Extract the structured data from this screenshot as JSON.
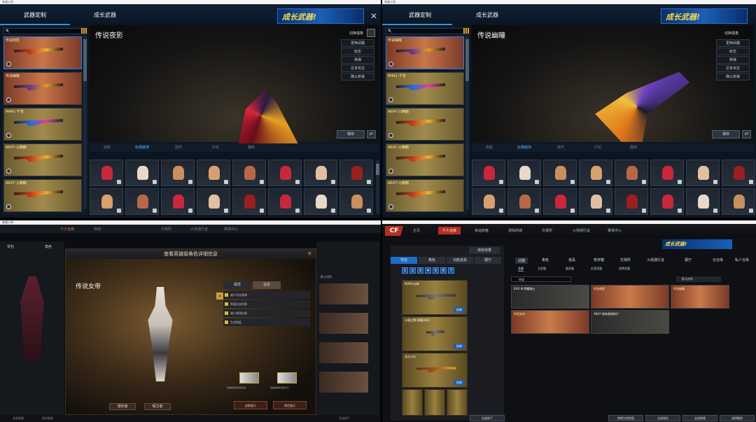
{
  "q1": {
    "winbar": "穿越火线",
    "tabs": [
      "武器定制",
      "成长武器"
    ],
    "banner": "成长武器!",
    "close": "✕",
    "stage_title": "传说夜影",
    "view_label": "切换视角",
    "menu": [
      "更换武器",
      "射击",
      "换弹",
      "近身攻击",
      "确认枪械"
    ],
    "save": "保存",
    "subtabs": [
      "皮肤",
      "玩偶装饰",
      "挂件",
      "印花",
      "翻转"
    ],
    "weapons": [
      "传说夜影",
      "传说幽瞳",
      "M4A1-千变",
      "AK47-火麒麟",
      "AK47-火麒麟"
    ]
  },
  "q2": {
    "winbar": "穿越火线",
    "tabs": [
      "武器定制",
      "成长武器"
    ],
    "banner": "成长武器!",
    "stage_title": "传说幽瞳",
    "view_label": "切换视角",
    "menu": [
      "更换武器",
      "射击",
      "换弹",
      "近身攻击",
      "确认枪械"
    ],
    "save": "保存",
    "subtabs": [
      "皮肤",
      "玩偶装饰",
      "挂件",
      "印花",
      "翻转"
    ],
    "weapons": [
      "传说幽瞳",
      "M4A1-千变",
      "AK47-火麒麟",
      "AK47-火麒麟",
      "AK47-火麒麟"
    ]
  },
  "q3": {
    "winbar": "穿越火线",
    "nav": [
      "个人仓库",
      "商城",
      "交易所",
      "火线通行证",
      "赛事中心"
    ],
    "left_tabs": [
      "背包",
      "角色"
    ],
    "modal_title": "查看英雄级角色详细信息",
    "hero_name": "传说女帝",
    "ptabs": [
      "属性",
      "设定"
    ],
    "skills": [
      "减少闪光效果",
      "免疫队友伤害",
      "减少掉落伤害",
      "生化免疫"
    ],
    "btn_left": "潜伏者",
    "btn_right": "保卫者",
    "portrait_desc": [
      "英雄级角色定制头像",
      "英雄级角色定制卡片"
    ],
    "bottom_buttons": [
      "皮肤展示",
      "角色展示"
    ],
    "footer": [
      "全部装备",
      "角色装备",
      "全部卸下"
    ],
    "right_label": "默认排序",
    "right_footer": "全部卸下"
  },
  "q4": {
    "logo": "CF",
    "nav": [
      "主页",
      "个人仓库",
      "幸运转盘",
      "游戏商城",
      "交易所",
      "火线通行证",
      "赛事中心"
    ],
    "banner": "成长武器!",
    "holding": "持有效果",
    "left_tabs": [
      "背包",
      "角色",
      "功能道具",
      "展厅"
    ],
    "nums": [
      "1",
      "2",
      "3",
      "4",
      "5",
      "6",
      "7"
    ],
    "left_weapons": [
      {
        "name": "M200-幻神",
        "dis": "拆卸"
      },
      {
        "name": "沙漠之鹰-荣耀2023",
        "dis": "拆卸"
      },
      {
        "name": "龙之爪刃",
        "dis": "拆卸"
      }
    ],
    "right_tabs": [
      "武器",
      "角色",
      "道具",
      "暂存箱",
      "交易所",
      "火线通行证",
      "展厅",
      "云仓库",
      "私人仓库"
    ],
    "subs": [
      "全部",
      "主武器",
      "副武器",
      "近身武器",
      "投掷武器"
    ],
    "search": "传说",
    "sort": "默认排序",
    "right_weapons": [
      {
        "name": "EVO III-荣耀骑士"
      },
      {
        "name": "传说夜影"
      },
      {
        "name": "传说幽瞳"
      },
      {
        "name": "传说女帝"
      },
      {
        "name": "AK47-皇帝青铜碎片"
      }
    ],
    "bottom": [
      "全部卸下",
      "转换为经验值",
      "全部保存",
      "全部修理",
      "选择删除"
    ]
  },
  "colors": {
    "accent": "#3b8fd6",
    "gold": "#e1a430",
    "cf_red": "#b43020"
  }
}
